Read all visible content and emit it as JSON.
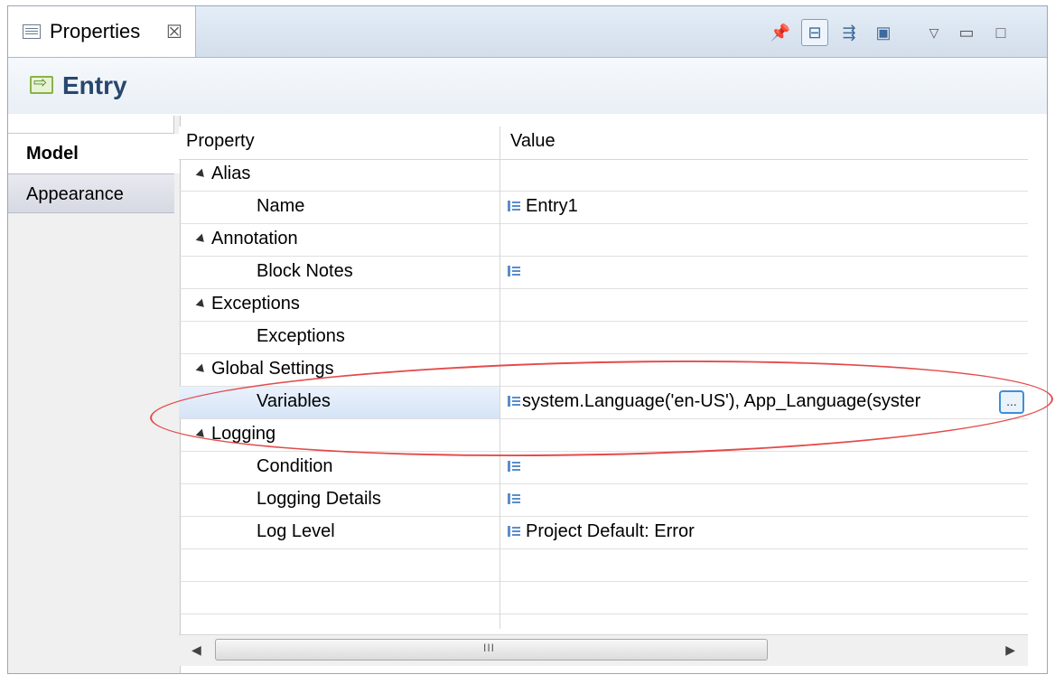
{
  "view": {
    "tab_label": "Properties",
    "tab_close": "☒",
    "title": "Entry"
  },
  "side_tabs": [
    {
      "label": "Model",
      "active": true
    },
    {
      "label": "Appearance",
      "active": false
    }
  ],
  "grid": {
    "headers": {
      "property": "Property",
      "value": "Value"
    },
    "rows": [
      {
        "type": "category",
        "label": "Alias"
      },
      {
        "type": "leaf",
        "label": "Name",
        "value": "Entry1",
        "icon": "text-value-icon"
      },
      {
        "type": "category",
        "label": "Annotation"
      },
      {
        "type": "leaf",
        "label": "Block Notes",
        "value": "",
        "icon": "text-value-icon"
      },
      {
        "type": "category",
        "label": "Exceptions"
      },
      {
        "type": "leaf",
        "label": "Exceptions",
        "value": "",
        "icon": ""
      },
      {
        "type": "category",
        "label": "Global Settings"
      },
      {
        "type": "leaf",
        "label": "Variables",
        "value": "system.Language('en-US'), App_Language(syster",
        "icon": "text-value-icon",
        "selected": true,
        "has_ellipsis": true
      },
      {
        "type": "category",
        "label": "Logging"
      },
      {
        "type": "leaf",
        "label": "Condition",
        "value": "",
        "icon": "text-value-icon"
      },
      {
        "type": "leaf",
        "label": "Logging Details",
        "value": "",
        "icon": "text-value-icon"
      },
      {
        "type": "leaf",
        "label": "Log Level",
        "value": "Project Default: Error",
        "icon": "text-value-icon"
      }
    ]
  },
  "ellipsis_label": "...",
  "scrollbar": {
    "left_arrow": "◀",
    "right_arrow": "▶",
    "grip": "III"
  },
  "colors": {
    "highlight": "#e44b4b",
    "accent": "#27476e"
  }
}
